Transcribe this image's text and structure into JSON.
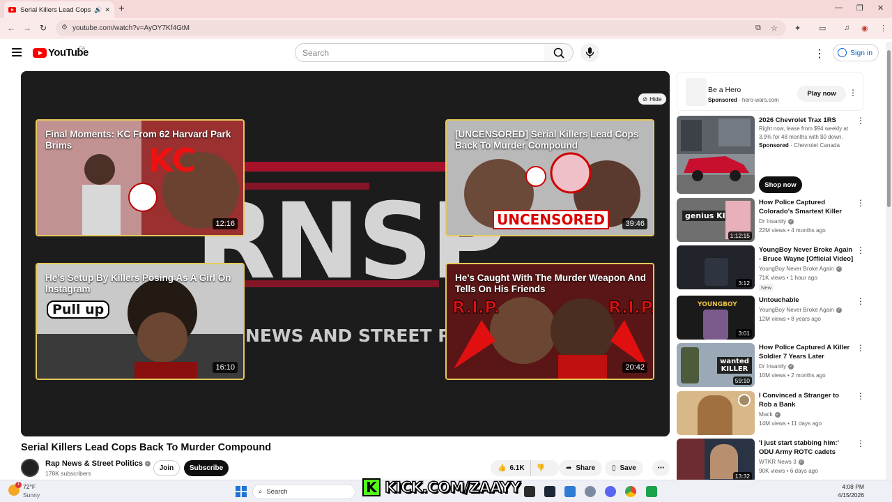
{
  "browser": {
    "tab_title": "Serial Killers Lead Cops Back",
    "url": "youtube.com/watch?v=AyOY7Kf4GtM",
    "colors": {
      "tabstrip": "#f5d8d8",
      "toolbar": "#fbeaea"
    }
  },
  "header": {
    "logo_text": "YouTube",
    "country_code": "CA",
    "search_placeholder": "Search",
    "sign_in": "Sign in"
  },
  "player": {
    "hide_label": "Hide",
    "background_wordmark": "RNSP",
    "background_tagline": "NEWS AND STREET POL",
    "endcards": [
      {
        "title": "Final Moments: KC From 62 Harvard Park Brims",
        "duration": "12:16",
        "art_text": "KC"
      },
      {
        "title": "[UNCENSORED] Serial Killers Lead Cops Back To Murder Compound",
        "duration": "39:46",
        "art_text": "UNCENSORED"
      },
      {
        "title": "He's Setup By Killers Posing As A Girl On Instagram",
        "duration": "16:10",
        "art_text": "Pull up"
      },
      {
        "title": "He's Caught With The Murder Weapon And Tells On His Friends",
        "duration": "20:42",
        "art_text": "R.I.P."
      }
    ]
  },
  "video": {
    "title": "Serial Killers Lead Cops Back To Murder Compound",
    "channel": "Rap News & Street Politics",
    "subscribers": "178K subscribers",
    "join": "Join",
    "subscribe": "Subscribe",
    "likes": "6.1K",
    "share": "Share",
    "save": "Save"
  },
  "sidebar": {
    "ad": {
      "title": "Be a Hero",
      "sponsored": "Sponsored",
      "domain": "hero-wars.com",
      "cta": "Play now"
    },
    "promo": {
      "title": "2026 Chevrolet Trax 1RS",
      "description": "Right now, lease from $94 weekly at 3.9% for 48 months with $0 down.",
      "sponsored": "Sponsored",
      "advertiser": "Chevrolet Canada",
      "cta": "Shop now"
    },
    "videos": [
      {
        "title": "How Police Captured Colorado's Smartest Killer",
        "channel": "Dr Insanity",
        "meta": "22M views • 4 months ago",
        "duration": "1:12:15",
        "art_text": "genius KILLER"
      },
      {
        "title": "YoungBoy Never Broke Again - Bruce Wayne [Official Video]",
        "channel": "YoungBoy Never Broke Again",
        "meta": "71K views • 1 hour ago",
        "duration": "3:12",
        "badge": "New"
      },
      {
        "title": "Untouchable",
        "channel": "YoungBoy Never Broke Again",
        "meta": "12M views • 8 years ago",
        "duration": "3:01",
        "art_text": "YOUNGBOY"
      },
      {
        "title": "How Police Captured A Killer Soldier 7 Years Later",
        "channel": "Dr Insanity",
        "meta": "10M views • 2 months ago",
        "duration": "59:10",
        "art_text": "wanted KILLER"
      },
      {
        "title": "I Convinced a Stranger to Rob a Bank",
        "channel": "Mack",
        "meta": "14M views • 11 days ago"
      },
      {
        "title": "'I just start stabbing him:' ODU Army ROTC cadets describe th...",
        "channel": "WTKR News 3",
        "meta": "90K views • 6 days ago",
        "duration": "13:32"
      }
    ]
  },
  "taskbar": {
    "temperature": "72°F",
    "condition": "Sunny",
    "search": "Search",
    "time": "4:08 PM",
    "date": "4/15/2026",
    "overlay_text": "KICK.COM/ZAAYY"
  }
}
